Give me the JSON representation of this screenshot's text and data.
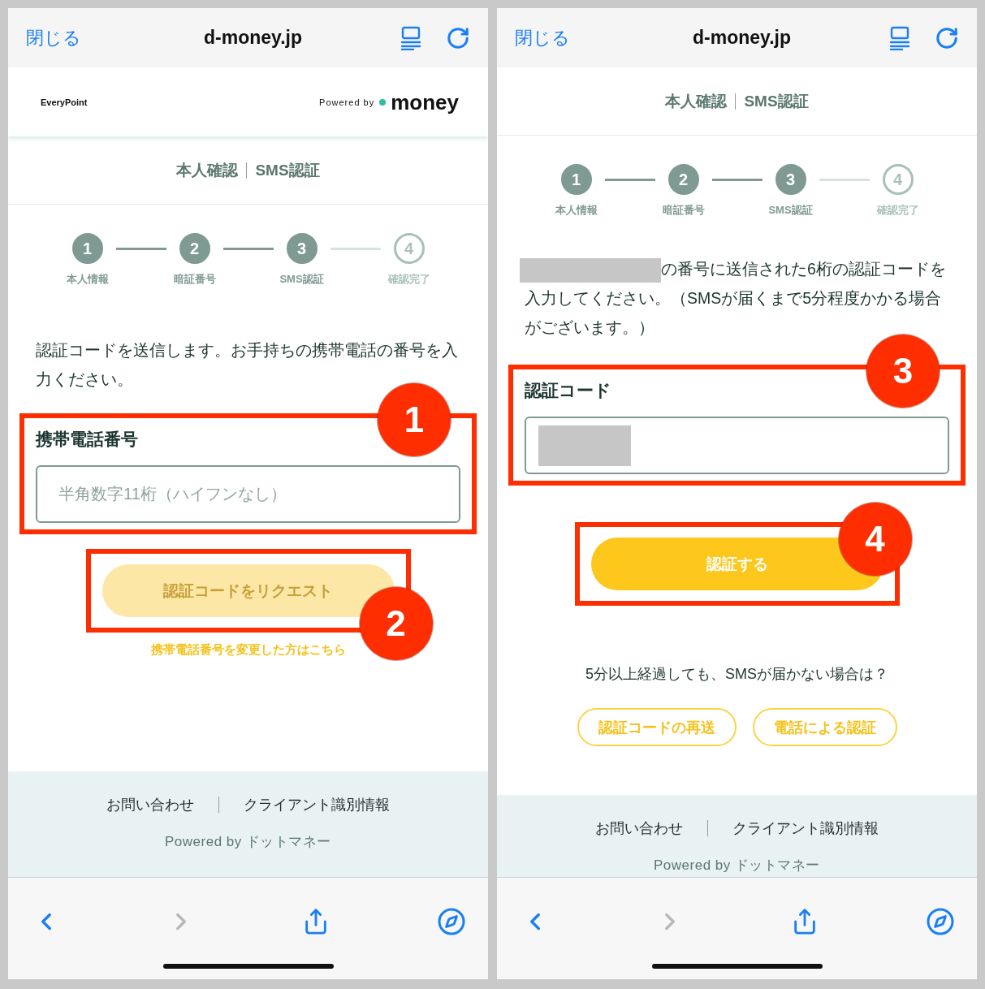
{
  "screens": [
    {
      "browser": {
        "close": "閉じる",
        "domain": "d-money.jp"
      },
      "brand": {
        "site": "EveryPoint",
        "powered_by": "Powered by",
        "provider": "money"
      },
      "page_title": {
        "main": "本人確認",
        "sub": "SMS認証"
      },
      "steps": [
        {
          "number": "1",
          "label": "本人情報",
          "completed": true
        },
        {
          "number": "2",
          "label": "暗証番号",
          "completed": true
        },
        {
          "number": "3",
          "label": "SMS認証",
          "completed": true
        },
        {
          "number": "4",
          "label": "確認完了",
          "completed": false
        }
      ],
      "blocks": [
        {
          "kind": "text",
          "text": "認証コードを送信します。お手持ちの携帯電話の番号を入力ください。"
        },
        {
          "kind": "field",
          "label": "携帯電話番号",
          "placeholder": "半角数字11桁（ハイフンなし）",
          "callout": {
            "number": "1"
          }
        },
        {
          "kind": "button",
          "label": "認証コードをリクエスト",
          "disabled": true,
          "callout": {
            "number": "2"
          }
        },
        {
          "kind": "link",
          "text": "携帯電話番号を変更した方はこちら"
        }
      ],
      "footer": {
        "links": [
          "お問い合わせ",
          "クライアント識別情報"
        ],
        "powered": "Powered by ドットマネー"
      },
      "toolbar": {
        "back_disabled": false,
        "forward_disabled": true
      }
    },
    {
      "browser": {
        "close": "閉じる",
        "domain": "d-money.jp"
      },
      "page_title": {
        "main": "本人確認",
        "sub": "SMS認証"
      },
      "steps": [
        {
          "number": "1",
          "label": "本人情報",
          "completed": true
        },
        {
          "number": "2",
          "label": "暗証番号",
          "completed": true
        },
        {
          "number": "3",
          "label": "SMS認証",
          "completed": true
        },
        {
          "number": "4",
          "label": "確認完了",
          "completed": false
        }
      ],
      "blocks": [
        {
          "kind": "text",
          "redacted_prefix": true,
          "text": "の番号に送信された6桁の認証コードを入力してください。（SMSが届くまで5分程度かかる場合がございます。）"
        },
        {
          "kind": "field",
          "label": "認証コード",
          "value_redacted": true,
          "callout": {
            "number": "3"
          }
        },
        {
          "kind": "button",
          "label": "認証する",
          "disabled": false,
          "callout": {
            "number": "4"
          }
        },
        {
          "kind": "question",
          "text": "5分以上経過しても、SMSが届かない場合は？"
        },
        {
          "kind": "outline_buttons",
          "buttons": [
            "認証コードの再送",
            "電話による認証"
          ]
        }
      ],
      "footer": {
        "links": [
          "お問い合わせ",
          "クライアント識別情報"
        ],
        "powered": "Powered by ドットマネー"
      },
      "toolbar": {
        "back_disabled": false,
        "forward_disabled": true
      }
    }
  ]
}
